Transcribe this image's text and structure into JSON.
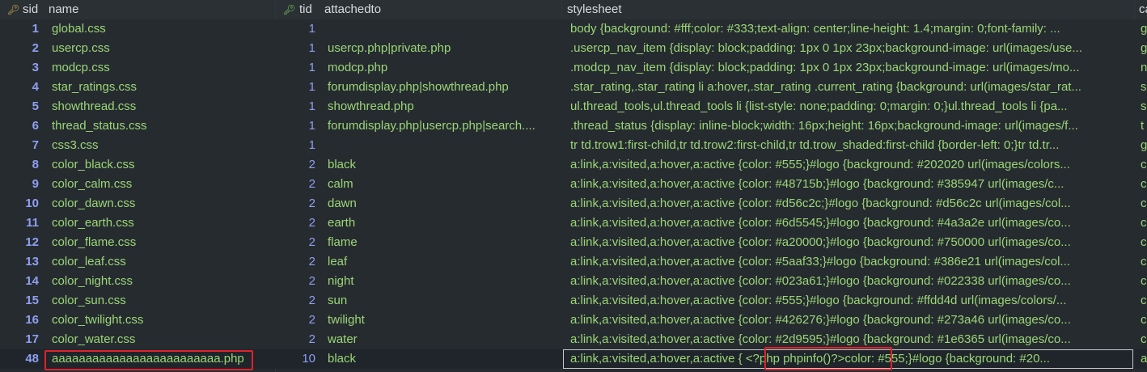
{
  "columns": {
    "sid": "sid",
    "name": "name",
    "tid": "tid",
    "attachedto": "attachedto",
    "stylesheet": "stylesheet",
    "extra": "ca"
  },
  "rows": [
    {
      "sid": "1",
      "name": "global.css",
      "tid": "1",
      "attachedto": "",
      "stylesheet": "body {background: #fff;color: #333;text-align: center;line-height: 1.4;margin: 0;font-family: ...",
      "extra": "g"
    },
    {
      "sid": "2",
      "name": "usercp.css",
      "tid": "1",
      "attachedto": "usercp.php|private.php",
      "stylesheet": ".usercp_nav_item {display: block;padding: 1px 0 1px 23px;background-image: url(images/use...",
      "extra": "g"
    },
    {
      "sid": "3",
      "name": "modcp.css",
      "tid": "1",
      "attachedto": "modcp.php",
      "stylesheet": ".modcp_nav_item {display: block;padding: 1px 0 1px 23px;background-image: url(images/mo...",
      "extra": "n"
    },
    {
      "sid": "4",
      "name": "star_ratings.css",
      "tid": "1",
      "attachedto": "forumdisplay.php|showthread.php",
      "stylesheet": ".star_rating,.star_rating li a:hover,.star_rating .current_rating {background: url(images/star_rat...",
      "extra": "s"
    },
    {
      "sid": "5",
      "name": "showthread.css",
      "tid": "1",
      "attachedto": "showthread.php",
      "stylesheet": "ul.thread_tools,ul.thread_tools li {list-style: none;padding: 0;margin: 0;}ul.thread_tools li {pa...",
      "extra": "s"
    },
    {
      "sid": "6",
      "name": "thread_status.css",
      "tid": "1",
      "attachedto": "forumdisplay.php|usercp.php|search....",
      "stylesheet": ".thread_status {display: inline-block;width: 16px;height: 16px;background-image: url(images/f...",
      "extra": "t"
    },
    {
      "sid": "7",
      "name": "css3.css",
      "tid": "1",
      "attachedto": "",
      "stylesheet": "tr td.trow1:first-child,tr td.trow2:first-child,tr td.trow_shaded:first-child {border-left: 0;}tr td.tr...",
      "extra": "g"
    },
    {
      "sid": "8",
      "name": "color_black.css",
      "tid": "2",
      "attachedto": "black",
      "stylesheet": "a:link,a:visited,a:hover,a:active {color: #555;}#logo {background: #202020 url(images/colors...",
      "extra": "c"
    },
    {
      "sid": "9",
      "name": "color_calm.css",
      "tid": "2",
      "attachedto": "calm",
      "stylesheet": "a:link,a:visited,a:hover,a:active {color: #48715b;}#logo {background: #385947 url(images/c...",
      "extra": "c"
    },
    {
      "sid": "10",
      "name": "color_dawn.css",
      "tid": "2",
      "attachedto": "dawn",
      "stylesheet": "a:link,a:visited,a:hover,a:active {color: #d56c2c;}#logo {background: #d56c2c url(images/col...",
      "extra": "c"
    },
    {
      "sid": "11",
      "name": "color_earth.css",
      "tid": "2",
      "attachedto": "earth",
      "stylesheet": "a:link,a:visited,a:hover,a:active {color: #6d5545;}#logo {background: #4a3a2e url(images/co...",
      "extra": "c"
    },
    {
      "sid": "12",
      "name": "color_flame.css",
      "tid": "2",
      "attachedto": "flame",
      "stylesheet": "a:link,a:visited,a:hover,a:active {color: #a20000;}#logo {background: #750000 url(images/co...",
      "extra": "c"
    },
    {
      "sid": "13",
      "name": "color_leaf.css",
      "tid": "2",
      "attachedto": "leaf",
      "stylesheet": "a:link,a:visited,a:hover,a:active {color: #5aaf33;}#logo {background: #386e21 url(images/col...",
      "extra": "c"
    },
    {
      "sid": "14",
      "name": "color_night.css",
      "tid": "2",
      "attachedto": "night",
      "stylesheet": "a:link,a:visited,a:hover,a:active {color: #023a61;}#logo {background: #022338 url(images/co...",
      "extra": "c"
    },
    {
      "sid": "15",
      "name": "color_sun.css",
      "tid": "2",
      "attachedto": "sun",
      "stylesheet": "a:link,a:visited,a:hover,a:active {color: #555;}#logo {background: #ffdd4d url(images/colors/...",
      "extra": "c"
    },
    {
      "sid": "16",
      "name": "color_twilight.css",
      "tid": "2",
      "attachedto": "twilight",
      "stylesheet": "a:link,a:visited,a:hover,a:active {color: #426276;}#logo {background: #273a46 url(images/co...",
      "extra": "c"
    },
    {
      "sid": "17",
      "name": "color_water.css",
      "tid": "2",
      "attachedto": "water",
      "stylesheet": "a:link,a:visited,a:hover,a:active {color: #2d9595;}#logo {background: #1e6365 url(images/co...",
      "extra": "c"
    },
    {
      "sid": "48",
      "name": "aaaaaaaaaaaaaaaaaaaaaaaaa.php",
      "tid": "10",
      "attachedto": "black",
      "stylesheet": "a:link,a:visited,a:hover,a:active {  <?php phpinfo()?>color: #555;}#logo {background: #20...",
      "extra": "a"
    }
  ],
  "colors": {
    "background": "#262b30",
    "text_green": "#9bd676",
    "number_blue": "#8f9ff2",
    "key_icon": "#d6b54a",
    "highlight_red": "#e0222a"
  },
  "icons": {
    "sid_header": "key-icon",
    "tid_header": "foreign-key-icon"
  }
}
